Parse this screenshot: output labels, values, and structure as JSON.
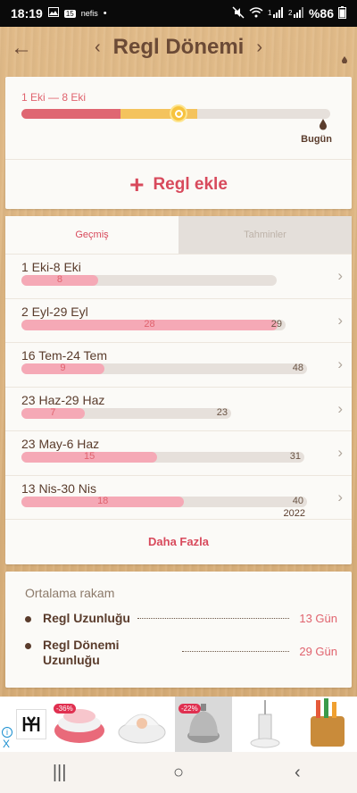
{
  "status": {
    "time": "18:19",
    "left_icons": [
      "image-icon",
      "notification-icon",
      "dot-icon"
    ],
    "app_badge": "nefis",
    "battery": "%86"
  },
  "header": {
    "title": "Regl Dönemi",
    "prev_symbol": "‹",
    "next_symbol": "›",
    "back_symbol": "←"
  },
  "cycle": {
    "range": "1 Eki — 8 Eki",
    "today_label": "Bugün",
    "period_fraction": 0.32,
    "fertile_start_fraction": 0.32,
    "fertile_end_fraction": 0.57,
    "ovulation_fraction": 0.51,
    "colors": {
      "period": "#df6672",
      "fertile": "#f4c35d",
      "ovulation": "#f7c33e"
    }
  },
  "add_button": {
    "label": "Regl ekle",
    "icon": "plus-icon"
  },
  "tabs": [
    {
      "label": "Geçmiş",
      "active": true
    },
    {
      "label": "Tahminler",
      "active": false
    }
  ],
  "history": [
    {
      "range": "1 Eki-8 Eki",
      "period_days": "8",
      "cycle_days": "",
      "period_fraction": 0.3,
      "cycle_fraction": 1.0
    },
    {
      "range": "2 Eyl-29 Eyl",
      "period_days": "28",
      "cycle_days": "29",
      "period_fraction": 0.97,
      "cycle_fraction": 1.0
    },
    {
      "range": "16 Tem-24 Tem",
      "period_days": "9",
      "cycle_days": "48",
      "period_fraction": 0.29,
      "cycle_fraction": 1.0
    },
    {
      "range": "23 Haz-29 Haz",
      "period_days": "7",
      "cycle_days": "23",
      "period_fraction": 0.3,
      "cycle_fraction": 1.0
    },
    {
      "range": "23 May-6 Haz",
      "period_days": "15",
      "cycle_days": "31",
      "period_fraction": 0.48,
      "cycle_fraction": 1.0
    },
    {
      "range": "13 Nis-30 Nis",
      "period_days": "18",
      "cycle_days": "40",
      "period_fraction": 0.57,
      "cycle_fraction": 1.0
    }
  ],
  "history_bar_widths_note": "",
  "year_label": "2022",
  "more_button": "Daha Fazla",
  "averages": {
    "title": "Ortalama rakam",
    "items": [
      {
        "label": "Regl Uzunluğu",
        "value": "13 Gün"
      },
      {
        "label": "Regl Dönemi\nUzunluğu",
        "value": "29 Gün"
      }
    ]
  },
  "ad": {
    "info_symbol": "i",
    "close_symbol": "X",
    "badges": [
      "-36%",
      "-22%"
    ]
  },
  "nav": {
    "recent": "|||",
    "home": "○",
    "back": "‹"
  }
}
